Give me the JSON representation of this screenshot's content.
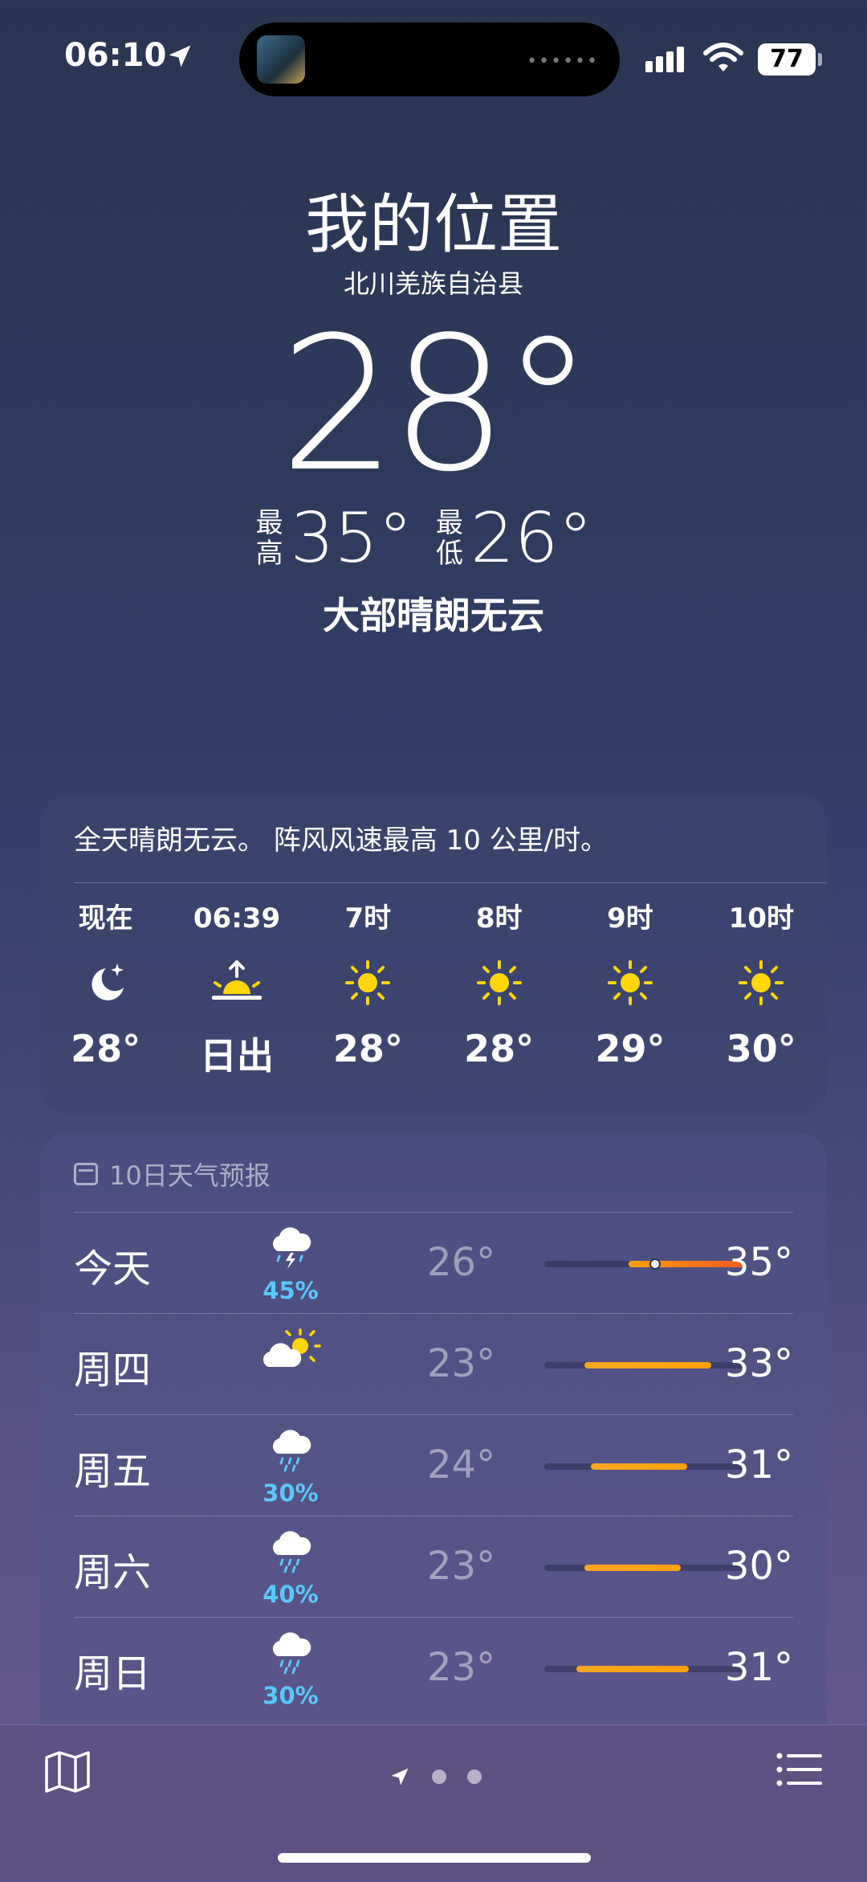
{
  "status": {
    "time": "06:10",
    "battery": "77"
  },
  "header": {
    "location_title": "我的位置",
    "location_sub": "北川羌族自治县",
    "current_temp": "28°",
    "high_label": "最高",
    "high": "35°",
    "low_label": "最低",
    "low": "26°",
    "condition": "大部晴朗无云"
  },
  "hourly": {
    "summary": "全天晴朗无云。 阵风风速最高 10 公里/时。",
    "items": [
      {
        "label": "现在",
        "icon": "moon-stars-icon",
        "value": "28°"
      },
      {
        "label": "06:39",
        "icon": "sunrise-icon",
        "value": "日出"
      },
      {
        "label": "7时",
        "icon": "sun-icon",
        "value": "28°"
      },
      {
        "label": "8时",
        "icon": "sun-icon",
        "value": "28°"
      },
      {
        "label": "9时",
        "icon": "sun-icon",
        "value": "29°"
      },
      {
        "label": "10时",
        "icon": "sun-icon",
        "value": "30°"
      }
    ]
  },
  "daily": {
    "title": "10日天气预报",
    "items": [
      {
        "day": "今天",
        "icon": "thunderstorm-icon",
        "pct": "45%",
        "low": "26°",
        "high": "35°",
        "range": [
          0.42,
          1.0
        ],
        "current": 0.55
      },
      {
        "day": "周四",
        "icon": "partly-sunny-icon",
        "pct": "",
        "low": "23°",
        "high": "33°",
        "range": [
          0.2,
          0.83
        ]
      },
      {
        "day": "周五",
        "icon": "rain-icon",
        "pct": "30%",
        "low": "24°",
        "high": "31°",
        "range": [
          0.23,
          0.71
        ]
      },
      {
        "day": "周六",
        "icon": "rain-icon",
        "pct": "40%",
        "low": "23°",
        "high": "30°",
        "range": [
          0.2,
          0.68
        ]
      },
      {
        "day": "周日",
        "icon": "rain-icon",
        "pct": "30%",
        "low": "23°",
        "high": "31°",
        "range": [
          0.16,
          0.72
        ]
      }
    ]
  },
  "colors": {
    "precip": "#5ac8fa",
    "sun": "#ffd60a",
    "bar_warm": "#ff9f0a",
    "bar_hot": "#ff5a1f"
  }
}
